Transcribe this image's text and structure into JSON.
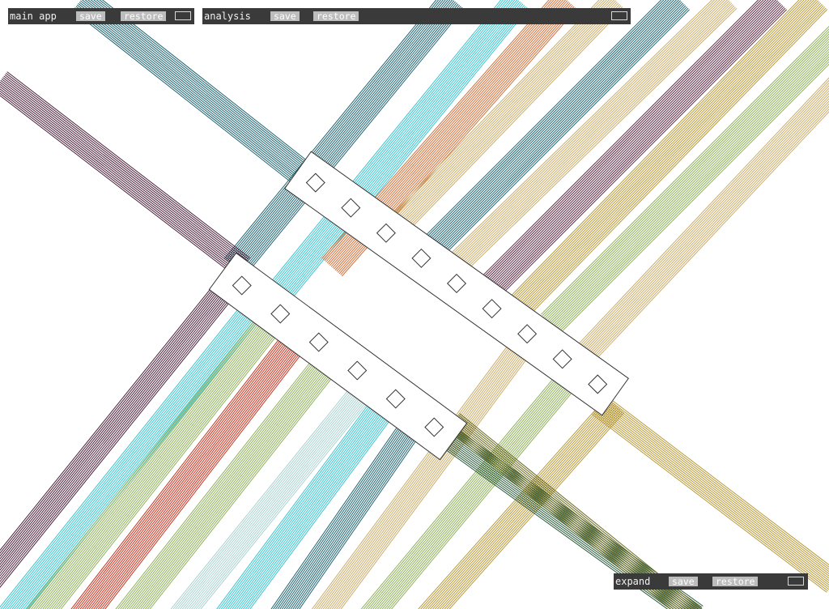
{
  "panels": {
    "main": {
      "title": "main app",
      "save": "save",
      "restore": "restore"
    },
    "analysis": {
      "title": "analysis",
      "save": "save",
      "restore": "restore"
    },
    "expand": {
      "title": "expand",
      "save": "save",
      "restore": "restore"
    }
  },
  "visualization": {
    "bundle_colors": [
      "#4a1f3a",
      "#1f6470",
      "#38c4d0",
      "#d0703a",
      "#c9ad6a",
      "#8fb05a",
      "#c8321e",
      "#a9d2d0",
      "#5a2a44",
      "#b89a3a",
      "#2a5a3a",
      "#6a6a20"
    ],
    "node_fill": "#ffffff",
    "node_stroke": "#333333"
  }
}
